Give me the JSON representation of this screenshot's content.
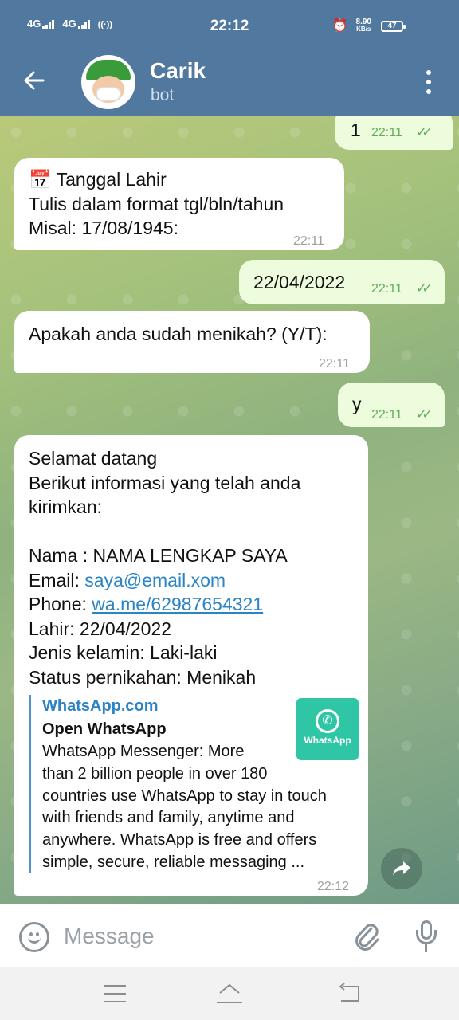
{
  "status_bar": {
    "net1": "4G",
    "net2": "4G",
    "hotspot_glyph": "((·))",
    "time": "22:12",
    "speed_value": "8.90",
    "speed_unit": "KB/s",
    "battery": "47"
  },
  "header": {
    "name": "Carik",
    "subtitle": "bot"
  },
  "messages": [
    {
      "id": "m1",
      "direction": "outgoing",
      "text": "1",
      "time": "22:11",
      "ticks": "✓✓"
    },
    {
      "id": "m2",
      "direction": "incoming",
      "emoji": "📅",
      "lines": [
        "Tanggal Lahir",
        "Tulis dalam format tgl/bln/tahun",
        "Misal: 17/08/1945:"
      ],
      "time": "22:11"
    },
    {
      "id": "m3",
      "direction": "outgoing",
      "text": "22/04/2022",
      "time": "22:11",
      "ticks": "✓✓"
    },
    {
      "id": "m4",
      "direction": "incoming",
      "text": "Apakah anda sudah menikah? (Y/T):",
      "time": "22:11"
    },
    {
      "id": "m5",
      "direction": "outgoing",
      "text": "y",
      "time": "22:11",
      "ticks": "✓✓"
    },
    {
      "id": "m6",
      "direction": "incoming",
      "greeting": "Selamat datang",
      "intro1": "Berikut informasi yang telah anda",
      "intro2": "kirimkan:",
      "nama": "Nama : NAMA LENGKAP SAYA",
      "email_label": "Email: ",
      "email": "saya@email.xom",
      "phone_label": "Phone: ",
      "phone": "wa.me/62987654321",
      "lahir": "Lahir: 22/04/2022",
      "jenis": "Jenis kelamin: Laki-laki",
      "status": "Status pernikahan: Menikah",
      "preview": {
        "site": "WhatsApp.com",
        "title": "Open WhatsApp",
        "desc_lines": [
          "WhatsApp Messenger: More",
          "than 2 billion people in over 180",
          "countries use WhatsApp to stay in touch",
          "with friends and family, anytime and",
          "anywhere. WhatsApp is free and offers",
          "simple, secure, reliable messaging ..."
        ],
        "thumb_label": "WhatsApp",
        "thumb_color": "#2ec6a4"
      },
      "time": "22:12"
    }
  ],
  "input": {
    "placeholder": "Message"
  },
  "colors": {
    "header_bg": "#51789f",
    "outgoing_bubble": "#eefcde",
    "incoming_bubble": "#ffffff",
    "link": "#2b84c5",
    "tick_green": "#5eae59"
  },
  "icons": {
    "back": "arrow-left-icon",
    "menu": "more-vertical-icon",
    "emoji": "smiley-icon",
    "attach": "paperclip-icon",
    "mic": "microphone-icon",
    "share": "share-arrow-icon"
  }
}
